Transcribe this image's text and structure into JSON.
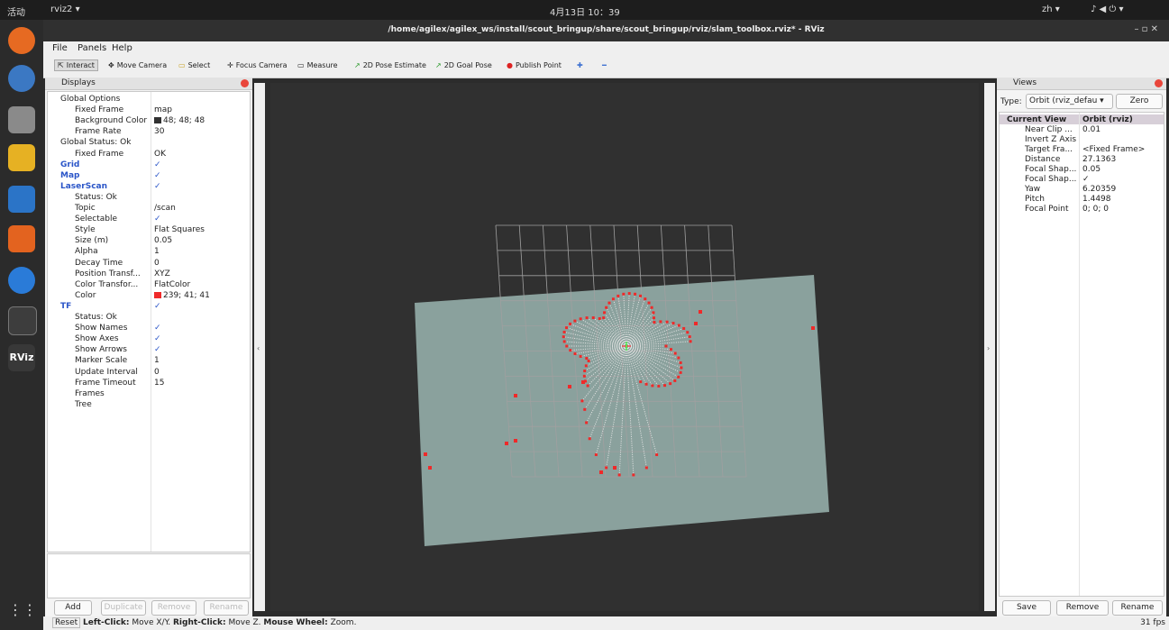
{
  "topbar": {
    "activities": "活动",
    "app": "rviz2 ▾",
    "clock": "4月13日 10：39",
    "lang": "zh ▾",
    "sys": "♪ ◀ ⏻ ▾"
  },
  "window": {
    "title": "/home/agilex/agilex_ws/install/scout_bringup/share/scout_bringup/rviz/slam_toolbox.rviz* - RViz",
    "controls": "–  ▫  ✕"
  },
  "dock": {
    "rviz_label": "RViz"
  },
  "menu": {
    "file": "File",
    "panels": "Panels",
    "help": "Help"
  },
  "toolbar": {
    "interact": "Interact",
    "move_camera": "Move Camera",
    "select": "Select",
    "focus_camera": "Focus Camera",
    "measure": "Measure",
    "pose_estimate": "2D Pose Estimate",
    "goal_pose": "2D Goal Pose",
    "publish_point": "Publish Point",
    "plus": "✚",
    "minus": "━"
  },
  "displays": {
    "title": "Displays",
    "rows": [
      {
        "label": "Global Options",
        "value": ""
      },
      {
        "label": "Fixed Frame",
        "value": "map"
      },
      {
        "label": "Background Color",
        "value": "48; 48; 48"
      },
      {
        "label": "Frame Rate",
        "value": "30"
      },
      {
        "label": "Global Status: Ok",
        "value": ""
      },
      {
        "label": "Fixed Frame",
        "value": "OK"
      },
      {
        "label": "Grid",
        "value": "✓"
      },
      {
        "label": "Map",
        "value": "✓"
      },
      {
        "label": "LaserScan",
        "value": "✓"
      },
      {
        "label": "Status: Ok",
        "value": ""
      },
      {
        "label": "Topic",
        "value": "/scan"
      },
      {
        "label": "Selectable",
        "value": "✓"
      },
      {
        "label": "Style",
        "value": "Flat Squares"
      },
      {
        "label": "Size (m)",
        "value": "0.05"
      },
      {
        "label": "Alpha",
        "value": "1"
      },
      {
        "label": "Decay Time",
        "value": "0"
      },
      {
        "label": "Position Transf...",
        "value": "XYZ"
      },
      {
        "label": "Color Transfor...",
        "value": "FlatColor"
      },
      {
        "label": "Color",
        "value": "239; 41; 41"
      },
      {
        "label": "TF",
        "value": "✓"
      },
      {
        "label": "Status: Ok",
        "value": ""
      },
      {
        "label": "Show Names",
        "value": "✓"
      },
      {
        "label": "Show Axes",
        "value": "✓"
      },
      {
        "label": "Show Arrows",
        "value": "✓"
      },
      {
        "label": "Marker Scale",
        "value": "1"
      },
      {
        "label": "Update Interval",
        "value": "0"
      },
      {
        "label": "Frame Timeout",
        "value": "15"
      },
      {
        "label": "Frames",
        "value": ""
      },
      {
        "label": "Tree",
        "value": ""
      }
    ],
    "add": "Add",
    "duplicate": "Duplicate",
    "remove": "Remove",
    "rename": "Rename"
  },
  "views": {
    "title": "Views",
    "type_label": "Type:",
    "type_value": "Orbit (rviz_defau ▾",
    "zero": "Zero",
    "rows": [
      {
        "label": "Current View",
        "value": "Orbit (rviz)"
      },
      {
        "label": "Near Clip ...",
        "value": "0.01"
      },
      {
        "label": "Invert Z Axis",
        "value": ""
      },
      {
        "label": "Target Fra...",
        "value": "<Fixed Frame>"
      },
      {
        "label": "Distance",
        "value": "27.1363"
      },
      {
        "label": "Focal Shap...",
        "value": "0.05"
      },
      {
        "label": "Focal Shap...",
        "value": "✓"
      },
      {
        "label": "Yaw",
        "value": "6.20359"
      },
      {
        "label": "Pitch",
        "value": "1.4498"
      },
      {
        "label": "Focal Point",
        "value": "0; 0; 0"
      }
    ],
    "save": "Save",
    "remove": "Remove",
    "rename": "Rename"
  },
  "status": {
    "reset": "Reset",
    "hint_lc": "Left-Click:",
    "hint_lc_t": "Move X/Y.",
    "hint_rc": "Right-Click:",
    "hint_rc_t": "Move Z.",
    "hint_mw": "Mouse Wheel:",
    "hint_mw_t": "Zoom.",
    "fps": "31 fps"
  },
  "colors": {
    "bg": "#303030",
    "map": "#8fa8a3",
    "laser": "#ef2929",
    "swatch_bg": "#303030"
  }
}
